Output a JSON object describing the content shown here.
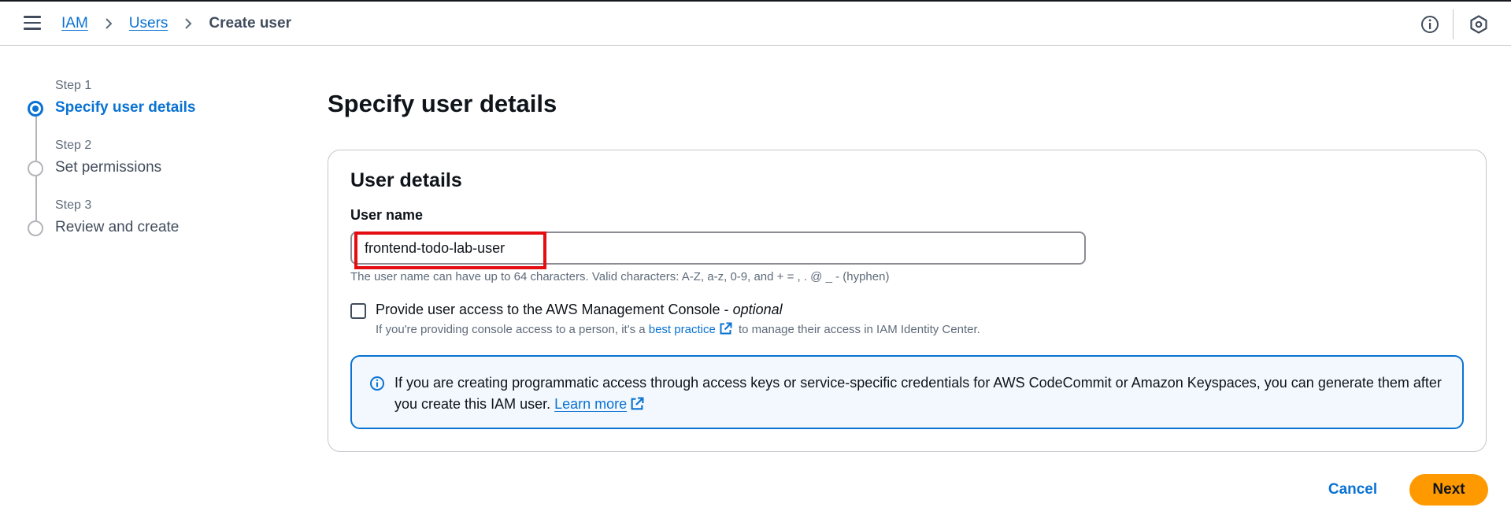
{
  "breadcrumb": {
    "items": [
      {
        "label": "IAM",
        "link": true
      },
      {
        "label": "Users",
        "link": true
      },
      {
        "label": "Create user",
        "link": false
      }
    ]
  },
  "header_icons": [
    "info-circle-icon",
    "security-hexagon-icon"
  ],
  "steps": [
    {
      "number": "Step 1",
      "title": "Specify user details",
      "state": "active"
    },
    {
      "number": "Step 2",
      "title": "Set permissions",
      "state": "inactive"
    },
    {
      "number": "Step 3",
      "title": "Review and create",
      "state": "inactive"
    }
  ],
  "main": {
    "page_title": "Specify user details",
    "container_title": "User details",
    "username": {
      "label": "User name",
      "value": "frontend-todo-lab-user",
      "constraint": "The user name can have up to 64 characters. Valid characters: A-Z, a-z, 0-9, and + = , . @ _ - (hyphen)"
    },
    "console_access": {
      "label": "Provide user access to the AWS Management Console - ",
      "optional": "optional",
      "checked": false,
      "desc_before": "If you're providing console access to a person, it's a ",
      "desc_link": "best practice",
      "desc_after": " to manage their access in IAM Identity Center."
    },
    "info_alert": {
      "text": "If you are creating programmatic access through access keys or service-specific credentials for AWS CodeCommit or Amazon Keyspaces, you can generate them after you create this IAM user. ",
      "link": "Learn more"
    }
  },
  "actions": {
    "cancel": "Cancel",
    "next": "Next"
  },
  "colors": {
    "accent": "#0972d3",
    "primary_button": "#ff9900",
    "highlight": "#e40d12",
    "info_bg": "#f2f8fd"
  }
}
